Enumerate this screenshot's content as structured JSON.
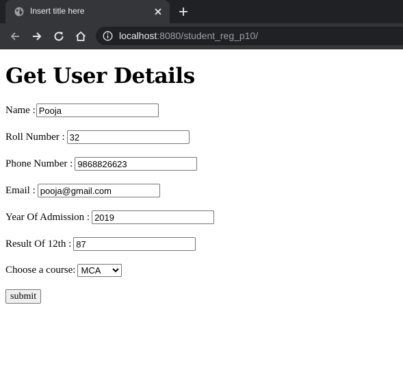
{
  "browser": {
    "tab_title": "Insert title here",
    "url_host": "localhost",
    "url_rest": ":8080/student_reg_p10/"
  },
  "page": {
    "title": "Get User Details"
  },
  "form": {
    "name": {
      "label": "Name :",
      "value": "Pooja"
    },
    "roll": {
      "label": "Roll Number :",
      "value": "32"
    },
    "phone": {
      "label": "Phone Number :",
      "value": "9868826623"
    },
    "email": {
      "label": "Email :",
      "value": "pooja@gmail.com"
    },
    "year": {
      "label": "Year Of Admission :",
      "value": "2019"
    },
    "result": {
      "label": "Result Of 12th :",
      "value": "87"
    },
    "course": {
      "label": "Choose a course:",
      "selected": "MCA"
    },
    "submit_label": "submit"
  }
}
